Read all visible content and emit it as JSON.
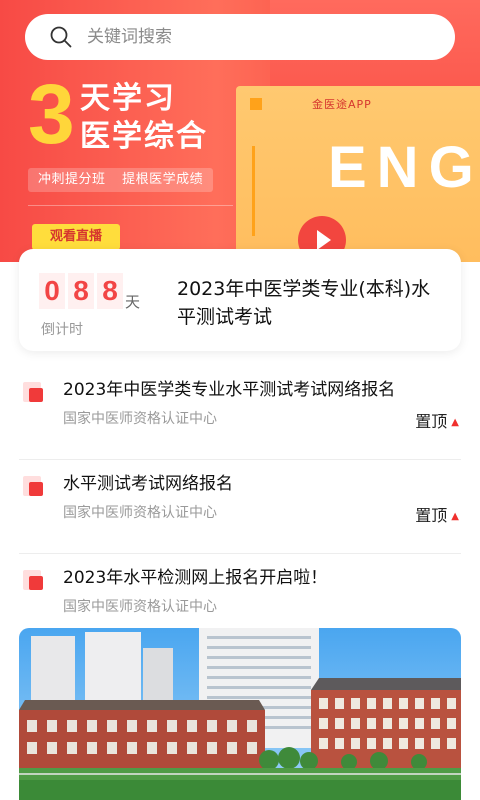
{
  "search": {
    "placeholder": "关键词搜索",
    "icon": "search-icon"
  },
  "banner": {
    "big_number": "3",
    "headline_line1": "天学习",
    "headline_line2": "医学综合",
    "sub_left": "冲刺提分班",
    "sub_right": "提根医学成绩",
    "live_button": "观看直播",
    "book_brand": "金医途APP",
    "book_text": "ENGL",
    "colors": {
      "accent_red": "#f24545",
      "accent_yellow": "#ffd63a",
      "book_orange": "#ffc970"
    }
  },
  "countdown": {
    "digits": [
      "0",
      "8",
      "8"
    ],
    "unit": "天",
    "label": "倒计时",
    "exam_title": "2023年中医学类专业(本科)水平测试考试"
  },
  "news": [
    {
      "title": "2023年中医学类专业水平测试考试网络报名",
      "source": "国家中医师资格认证中心",
      "pin": "置顶"
    },
    {
      "title": "水平测试考试网络报名",
      "source": "国家中医师资格认证中心",
      "pin": "置顶"
    },
    {
      "title": "2023年水平检测网上报名开启啦！",
      "source": "国家中医师资格认证中心",
      "pin": ""
    }
  ]
}
